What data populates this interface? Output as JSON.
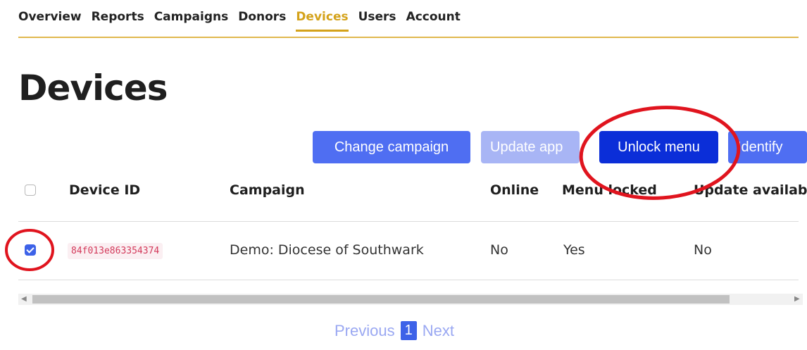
{
  "nav": {
    "items": [
      {
        "label": "Overview",
        "active": false
      },
      {
        "label": "Reports",
        "active": false
      },
      {
        "label": "Campaigns",
        "active": false
      },
      {
        "label": "Donors",
        "active": false
      },
      {
        "label": "Devices",
        "active": true
      },
      {
        "label": "Users",
        "active": false
      },
      {
        "label": "Account",
        "active": false
      }
    ]
  },
  "page": {
    "title": "Devices"
  },
  "toolbar": {
    "change_campaign": "Change campaign",
    "update_app": "Update app",
    "unlock_menu": "Unlock menu",
    "identify": "Identify"
  },
  "table": {
    "headers": {
      "device_id": "Device ID",
      "campaign": "Campaign",
      "online": "Online",
      "menu_locked": "Menu locked",
      "update_available": "Update available"
    },
    "rows": [
      {
        "selected": true,
        "device_id": "84f013e863354374",
        "campaign": "Demo: Diocese of Southwark",
        "online": "No",
        "menu_locked": "Yes",
        "update_available": "No"
      }
    ]
  },
  "pagination": {
    "previous": "Previous",
    "current": "1",
    "next": "Next"
  },
  "colors": {
    "accent": "#d4a21a",
    "primary": "#4f6ef2",
    "primary_dark": "#0b2ed8",
    "annotation": "#e0141e"
  }
}
